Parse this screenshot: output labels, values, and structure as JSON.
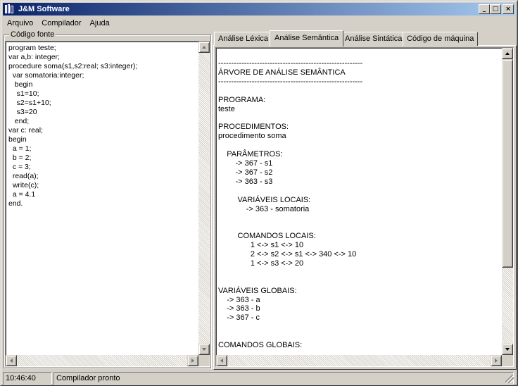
{
  "window": {
    "title": "J&M Software"
  },
  "title_buttons": {
    "minimize": "_",
    "maximize": "□",
    "close": "×"
  },
  "menu": {
    "items": [
      "Arquivo",
      "Compilador",
      "Ajuda"
    ]
  },
  "source_panel": {
    "label": "Código fonte",
    "code": "program teste;\nvar a,b: integer;\nprocedure soma(s1,s2:real; s3:integer);\n  var somatoria:integer;\n   begin\n    s1=10;\n    s2=s1+10;\n    s3=20\n   end;\nvar c: real;\nbegin\n  a = 1;\n  b = 2;\n  c = 3;\n  read(a);\n  write(c);\n  a = 4.1\nend."
  },
  "tabs": [
    {
      "label": "Análise Léxica",
      "active": false
    },
    {
      "label": "Análise Semântica",
      "active": true
    },
    {
      "label": "Análise Sintática",
      "active": false
    },
    {
      "label": "Código de máquina",
      "active": false
    }
  ],
  "output": {
    "text": "--------------------------------------------------------\nÁRVORE DE ANÁLISE SEMÂNTICA\n--------------------------------------------------------\n\nPROGRAMA:\nteste\n\nPROCEDIMENTOS:\nprocedimento soma\n\n    PARÂMETROS:\n        -> 367 - s1\n        -> 367 - s2\n        -> 363 - s3\n\n         VARIÁVEIS LOCAIS:\n             -> 363 - somatoria\n\n\n         COMANDOS LOCAIS:\n               1 <-> s1 <-> 10\n               2 <-> s2 <-> s1 <-> 340 <-> 10\n               1 <-> s3 <-> 20\n\n\nVARIÁVEIS GLOBAIS:\n    -> 363 - a\n    -> 363 - b\n    -> 367 - c\n\n\nCOMANDOS GLOBAIS:"
  },
  "statusbar": {
    "time": "10:46:40",
    "message": "Compilador pronto"
  },
  "colors": {
    "face": "#d4d0c8",
    "title_start": "#0a246a",
    "title_end": "#a6caf0"
  }
}
